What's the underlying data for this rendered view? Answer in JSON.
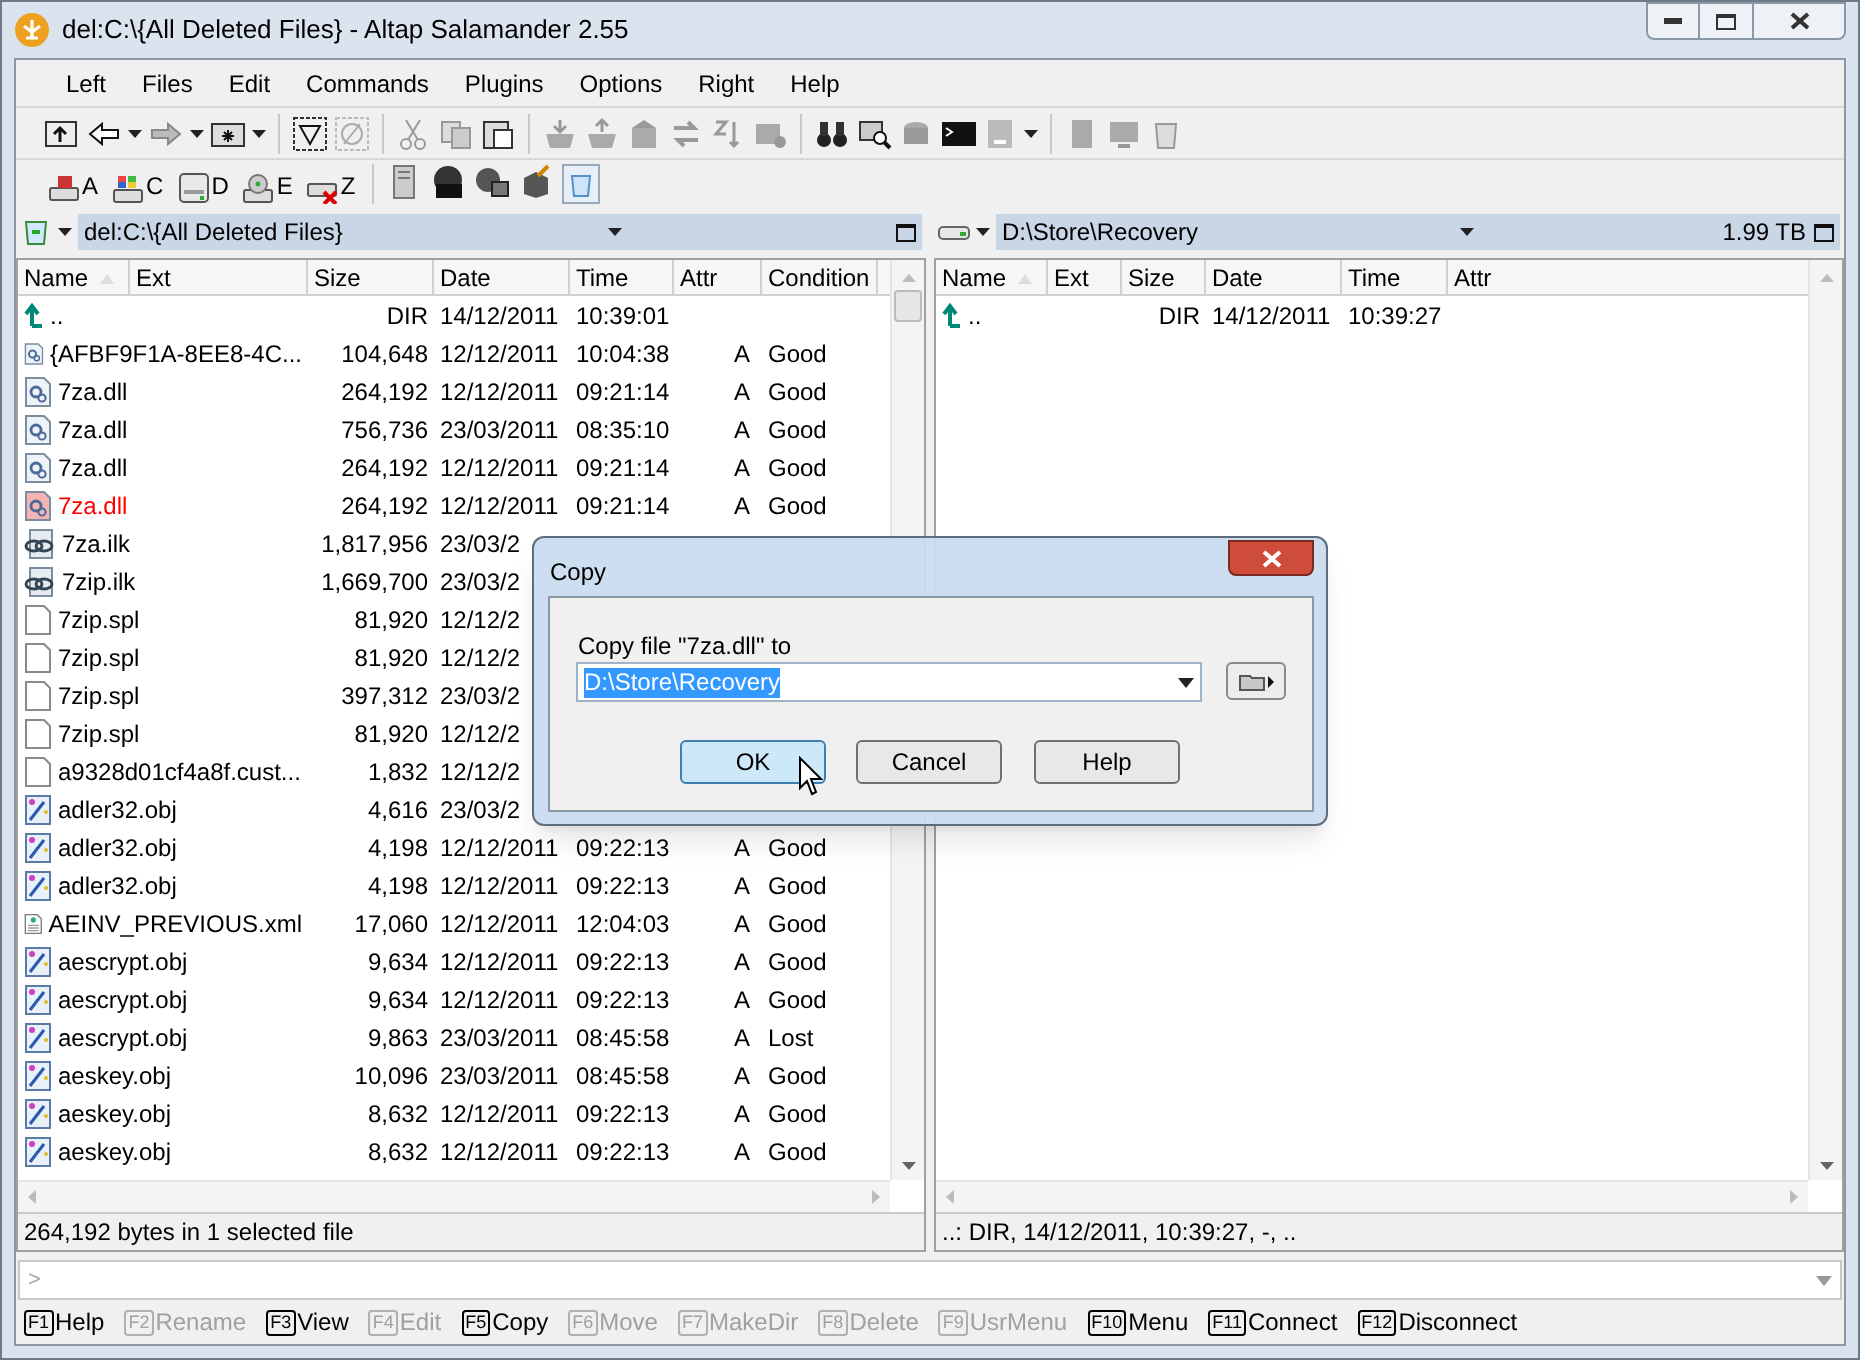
{
  "window": {
    "title": "del:C:\\{All Deleted Files} - Altap Salamander 2.55"
  },
  "menu": [
    "Left",
    "Files",
    "Edit",
    "Commands",
    "Plugins",
    "Options",
    "Right",
    "Help"
  ],
  "drive_bar": [
    "A",
    "C",
    "D",
    "E",
    "Z"
  ],
  "left_panel": {
    "path": "del:C:\\{All Deleted Files}",
    "columns": [
      "Name",
      "Ext",
      "Size",
      "Date",
      "Time",
      "Attr",
      "Condition"
    ],
    "rows": [
      {
        "kind": "up",
        "name": "..",
        "size": "DIR",
        "date": "14/12/2011",
        "time": "10:39:01",
        "selected": false
      },
      {
        "kind": "dll",
        "name": "{AFBF9F1A-8EE8-4C...",
        "size": "104,648",
        "date": "12/12/2011",
        "time": "10:04:38",
        "attr": "A",
        "condition": "Good",
        "selected": false
      },
      {
        "kind": "dll",
        "name": "7za.dll",
        "size": "264,192",
        "date": "12/12/2011",
        "time": "09:21:14",
        "attr": "A",
        "condition": "Good",
        "selected": false
      },
      {
        "kind": "dll",
        "name": "7za.dll",
        "size": "756,736",
        "date": "23/03/2011",
        "time": "08:35:10",
        "attr": "A",
        "condition": "Good",
        "selected": false
      },
      {
        "kind": "dll",
        "name": "7za.dll",
        "size": "264,192",
        "date": "12/12/2011",
        "time": "09:21:14",
        "attr": "A",
        "condition": "Good",
        "selected": false
      },
      {
        "kind": "dll",
        "name": "7za.dll",
        "size": "264,192",
        "date": "12/12/2011",
        "time": "09:21:14",
        "attr": "A",
        "condition": "Good",
        "selected": true
      },
      {
        "kind": "ilk",
        "name": "7za.ilk",
        "size": "1,817,956",
        "date": "23/03/2",
        "selected": false
      },
      {
        "kind": "ilk",
        "name": "7zip.ilk",
        "size": "1,669,700",
        "date": "23/03/2",
        "selected": false
      },
      {
        "kind": "spl",
        "name": "7zip.spl",
        "size": "81,920",
        "date": "12/12/2",
        "selected": false
      },
      {
        "kind": "spl",
        "name": "7zip.spl",
        "size": "81,920",
        "date": "12/12/2",
        "selected": false
      },
      {
        "kind": "spl",
        "name": "7zip.spl",
        "size": "397,312",
        "date": "23/03/2",
        "selected": false
      },
      {
        "kind": "spl",
        "name": "7zip.spl",
        "size": "81,920",
        "date": "12/12/2",
        "selected": false
      },
      {
        "kind": "spl",
        "name": "a9328d01cf4a8f.cust...",
        "size": "1,832",
        "date": "12/12/2",
        "selected": false
      },
      {
        "kind": "obj",
        "name": "adler32.obj",
        "size": "4,616",
        "date": "23/03/2",
        "selected": false
      },
      {
        "kind": "obj",
        "name": "adler32.obj",
        "size": "4,198",
        "date": "12/12/2011",
        "time": "09:22:13",
        "attr": "A",
        "condition": "Good",
        "selected": false
      },
      {
        "kind": "obj",
        "name": "adler32.obj",
        "size": "4,198",
        "date": "12/12/2011",
        "time": "09:22:13",
        "attr": "A",
        "condition": "Good",
        "selected": false
      },
      {
        "kind": "xml",
        "name": "AEINV_PREVIOUS.xml",
        "size": "17,060",
        "date": "12/12/2011",
        "time": "12:04:03",
        "attr": "A",
        "condition": "Good",
        "selected": false
      },
      {
        "kind": "obj",
        "name": "aescrypt.obj",
        "size": "9,634",
        "date": "12/12/2011",
        "time": "09:22:13",
        "attr": "A",
        "condition": "Good",
        "selected": false
      },
      {
        "kind": "obj",
        "name": "aescrypt.obj",
        "size": "9,634",
        "date": "12/12/2011",
        "time": "09:22:13",
        "attr": "A",
        "condition": "Good",
        "selected": false
      },
      {
        "kind": "obj",
        "name": "aescrypt.obj",
        "size": "9,863",
        "date": "23/03/2011",
        "time": "08:45:58",
        "attr": "A",
        "condition": "Lost",
        "selected": false
      },
      {
        "kind": "obj",
        "name": "aeskey.obj",
        "size": "10,096",
        "date": "23/03/2011",
        "time": "08:45:58",
        "attr": "A",
        "condition": "Good",
        "selected": false
      },
      {
        "kind": "obj",
        "name": "aeskey.obj",
        "size": "8,632",
        "date": "12/12/2011",
        "time": "09:22:13",
        "attr": "A",
        "condition": "Good",
        "selected": false
      },
      {
        "kind": "obj",
        "name": "aeskey.obj",
        "size": "8,632",
        "date": "12/12/2011",
        "time": "09:22:13",
        "attr": "A",
        "condition": "Good",
        "selected": false
      }
    ],
    "status": "264,192 bytes in 1 selected file"
  },
  "right_panel": {
    "path": "D:\\Store\\Recovery",
    "free_space": "1.99 TB",
    "columns": [
      "Name",
      "Ext",
      "Size",
      "Date",
      "Time",
      "Attr"
    ],
    "rows": [
      {
        "kind": "up",
        "name": "..",
        "size": "DIR",
        "date": "14/12/2011",
        "time": "10:39:27",
        "selected": false
      }
    ],
    "status": "..: DIR, 14/12/2011, 10:39:27, -, .."
  },
  "command_line": {
    "prompt": ">"
  },
  "function_keys": [
    {
      "key": "F1",
      "label": "Help",
      "disabled": false
    },
    {
      "key": "F2",
      "label": "Rename",
      "disabled": true
    },
    {
      "key": "F3",
      "label": "View",
      "disabled": false
    },
    {
      "key": "F4",
      "label": "Edit",
      "disabled": true
    },
    {
      "key": "F5",
      "label": "Copy",
      "disabled": false
    },
    {
      "key": "F6",
      "label": "Move",
      "disabled": true
    },
    {
      "key": "F7",
      "label": "MakeDir",
      "disabled": true
    },
    {
      "key": "F8",
      "label": "Delete",
      "disabled": true
    },
    {
      "key": "F9",
      "label": "UsrMenu",
      "disabled": true
    },
    {
      "key": "F10",
      "label": "Menu",
      "disabled": false
    },
    {
      "key": "F11",
      "label": "Connect",
      "disabled": false
    },
    {
      "key": "F12",
      "label": "Disconnect",
      "disabled": false
    }
  ],
  "dialog": {
    "title": "Copy",
    "label": "Copy file \"7za.dll\" to",
    "value": "D:\\Store\\Recovery",
    "buttons": [
      {
        "label": "OK",
        "default": true
      },
      {
        "label": "Cancel",
        "default": false
      },
      {
        "label": "Help",
        "default": false
      }
    ]
  }
}
